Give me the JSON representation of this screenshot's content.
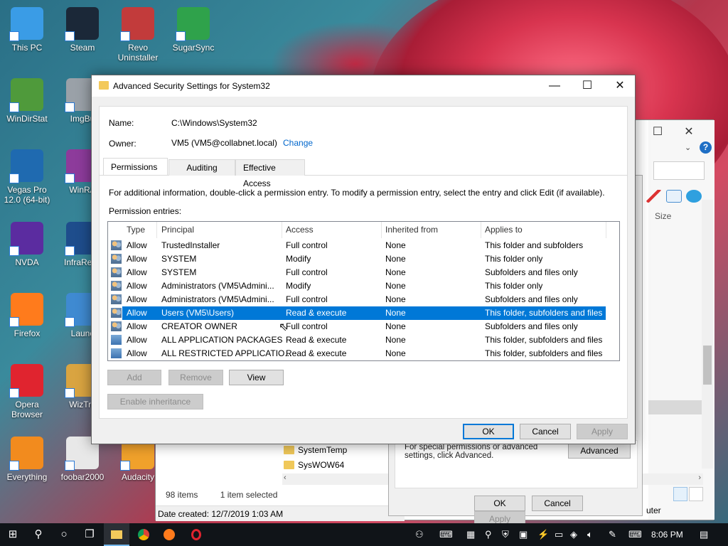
{
  "desktop": {
    "icons": [
      {
        "label": "This PC",
        "color": "#3a9ce6"
      },
      {
        "label": "Steam",
        "color": "#1b2838"
      },
      {
        "label": "Revo Uninstaller",
        "color": "#c23b3b"
      },
      {
        "label": "SugarSync",
        "color": "#2fa24b"
      },
      {
        "label": "WinDirStat",
        "color": "#4f9a3b"
      },
      {
        "label": "ImgBu",
        "color": "#9aa1a8"
      },
      {
        "label": "Vegas Pro 12.0 (64-bit)",
        "color": "#1f6ab0"
      },
      {
        "label": "WinRA",
        "color": "#8d3b9b"
      },
      {
        "label": "NVDA",
        "color": "#5b2ca0"
      },
      {
        "label": "InfraReco",
        "color": "#1e4d8c"
      },
      {
        "label": "Firefox",
        "color": "#ff7b1c"
      },
      {
        "label": "Launc",
        "color": "#3f8ad1"
      },
      {
        "label": "Opera Browser",
        "color": "#e0242f"
      },
      {
        "label": "WizTre",
        "color": "#d9a441"
      },
      {
        "label": "Everything",
        "color": "#f28b1e"
      },
      {
        "label": "foobar2000",
        "color": "#e8e8e8"
      },
      {
        "label": "Audacity",
        "color": "#f0a12b"
      }
    ]
  },
  "bg_explorer": {
    "size_col": "Size",
    "files": [
      "SystemTemp",
      "SysWOW64"
    ],
    "status_items": "98 items",
    "status_selected": "1 item selected",
    "date_created": "Date created: 12/7/2019 1:03 AM",
    "help_icon": "?"
  },
  "props_window": {
    "hint": "For special permissions or advanced settings, click Advanced.",
    "advanced": "Advanced",
    "ok": "OK",
    "cancel": "Cancel",
    "apply": "Apply",
    "partial_text": "uter"
  },
  "dialog": {
    "title": "Advanced Security Settings for System32",
    "name_label": "Name:",
    "name_value": "C:\\Windows\\System32",
    "owner_label": "Owner:",
    "owner_value": "VM5 (VM5@collabnet.local)",
    "change_link": "Change",
    "tabs": [
      "Permissions",
      "Auditing",
      "Effective Access"
    ],
    "info_text": "For additional information, double-click a permission entry. To modify a permission entry, select the entry and click Edit (if available).",
    "entries_label": "Permission entries:",
    "columns": [
      "Type",
      "Principal",
      "Access",
      "Inherited from",
      "Applies to"
    ],
    "rows": [
      [
        "Allow",
        "TrustedInstaller",
        "Full control",
        "None",
        "This folder and subfolders"
      ],
      [
        "Allow",
        "SYSTEM",
        "Modify",
        "None",
        "This folder only"
      ],
      [
        "Allow",
        "SYSTEM",
        "Full control",
        "None",
        "Subfolders and files only"
      ],
      [
        "Allow",
        "Administrators (VM5\\Admini...",
        "Modify",
        "None",
        "This folder only"
      ],
      [
        "Allow",
        "Administrators (VM5\\Admini...",
        "Full control",
        "None",
        "Subfolders and files only"
      ],
      [
        "Allow",
        "Users (VM5\\Users)",
        "Read & execute",
        "None",
        "This folder, subfolders and files"
      ],
      [
        "Allow",
        "CREATOR OWNER",
        "Full control",
        "None",
        "Subfolders and files only"
      ],
      [
        "Allow",
        "ALL APPLICATION PACKAGES",
        "Read & execute",
        "None",
        "This folder, subfolders and files"
      ],
      [
        "Allow",
        "ALL RESTRICTED APPLICATIO...",
        "Read & execute",
        "None",
        "This folder, subfolders and files"
      ]
    ],
    "selected_row": 5,
    "add": "Add",
    "remove": "Remove",
    "view": "View",
    "enable_inheritance": "Enable inheritance",
    "ok": "OK",
    "cancel": "Cancel",
    "apply": "Apply",
    "accent": "#0078d7"
  },
  "taskbar": {
    "time": "8:06 PM",
    "accent": "#76b9ed"
  }
}
